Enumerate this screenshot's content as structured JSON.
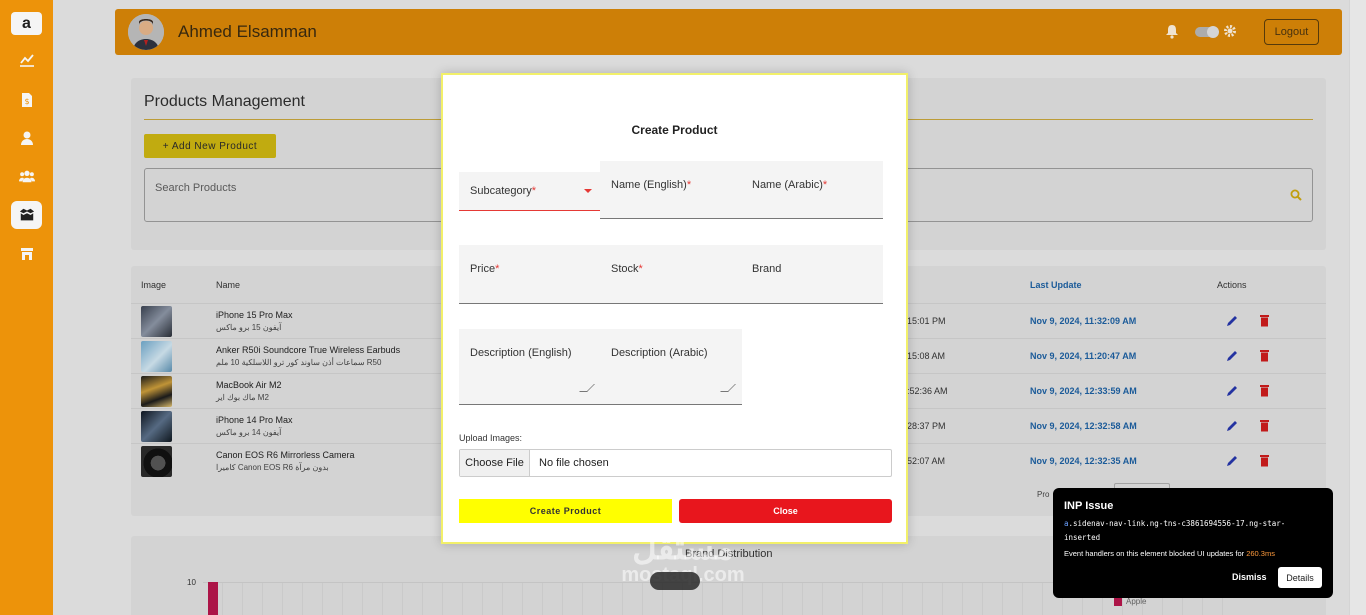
{
  "sidebar": {
    "logo": "a",
    "items": [
      {
        "icon": "chart-line-icon"
      },
      {
        "icon": "dollar-file-icon"
      },
      {
        "icon": "user-icon"
      },
      {
        "icon": "users-icon"
      },
      {
        "icon": "box-icon",
        "active": true
      },
      {
        "icon": "store-icon"
      }
    ]
  },
  "header": {
    "user_name": "Ahmed Elsamman",
    "logout_label": "Logout"
  },
  "products": {
    "title": "Products Management",
    "add_label": "+ Add New Product",
    "search_placeholder": "Search Products"
  },
  "table": {
    "columns": {
      "image": "Image",
      "name": "Name",
      "last_update": "Last Update",
      "actions": "Actions"
    },
    "rows": [
      {
        "name": "iPhone 15 Pro Max",
        "name_ar": "آيفون 15 برو ماكس",
        "created": "15:01 PM",
        "updated": "Nov 9, 2024, 11:32:09 AM"
      },
      {
        "name": "Anker R50i Soundcore True Wireless Earbuds",
        "name_ar": "سماعات أذن ساوند كور ترو اللاسلكية 10 ملم R50",
        "created": "15:08 AM",
        "updated": "Nov 9, 2024, 11:20:47 AM"
      },
      {
        "name": "MacBook Air M2",
        "name_ar": "ماك بوك اير M2",
        "created": ":52:36 AM",
        "updated": "Nov 9, 2024, 12:33:59 AM"
      },
      {
        "name": "iPhone 14 Pro Max",
        "name_ar": "آيفون 14 برو ماكس",
        "created": "28:37 PM",
        "updated": "Nov 9, 2024, 12:32:58 AM"
      },
      {
        "name": "Canon EOS R6 Mirrorless Camera",
        "name_ar": "كاميرا Canon EOS R6 بدون مرآة",
        "created": "52:07 AM",
        "updated": "Nov 9, 2024, 12:32:35 AM"
      }
    ],
    "pager_label": "Pro"
  },
  "chart": {
    "title": "Brand Distribution",
    "y_tick": "10",
    "legend": "Apple"
  },
  "modal": {
    "title": "Create Product",
    "subcategory": "Subcategory",
    "name_en": "Name (English)",
    "name_ar": "Name (Arabic)",
    "price": "Price",
    "stock": "Stock",
    "brand": "Brand",
    "desc_en": "Description (English)",
    "desc_ar": "Description (Arabic)",
    "upload_label": "Upload Images:",
    "choose_file": "Choose File",
    "no_file": "No file chosen",
    "create_label": "Create Product",
    "close_label": "Close",
    "required_mark": "*"
  },
  "watermark": {
    "ar": "مستقل",
    "en": "mostaql.com"
  },
  "inp": {
    "title": "INP Issue",
    "selector_tag": "a",
    "selector": ".sidenav-nav-link.ng-tns-c3861694556-17.ng-star-inserted",
    "message": "Event handlers on this element blocked UI updates for",
    "duration": "260.3ms",
    "dismiss": "Dismiss",
    "details": "Details"
  },
  "colors": {
    "sidebar": "#f79a0b",
    "header": "#d68508",
    "create_button": "#ffff00",
    "close_button": "#e8161d",
    "link_blue": "#1d5fa0"
  }
}
